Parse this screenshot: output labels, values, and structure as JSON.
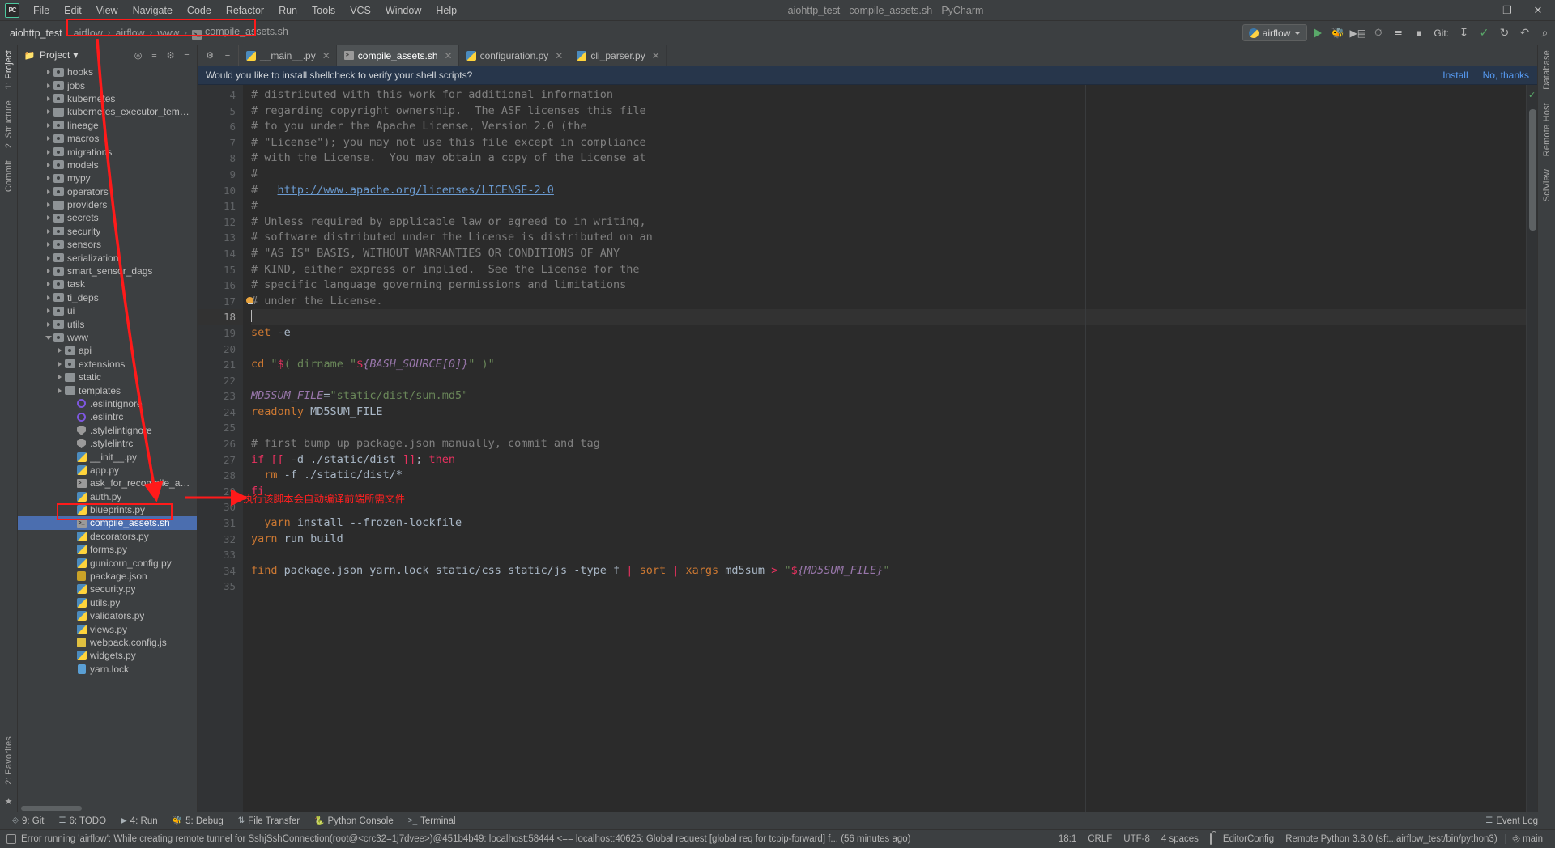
{
  "window": {
    "title": "aiohttp_test - compile_assets.sh - PyCharm",
    "minimize": "—",
    "maximize": "❐",
    "close": "✕"
  },
  "menubar": [
    {
      "label": "File"
    },
    {
      "label": "Edit"
    },
    {
      "label": "View"
    },
    {
      "label": "Navigate"
    },
    {
      "label": "Code"
    },
    {
      "label": "Refactor"
    },
    {
      "label": "Run"
    },
    {
      "label": "Tools"
    },
    {
      "label": "VCS"
    },
    {
      "label": "Window"
    },
    {
      "label": "Help"
    }
  ],
  "navbar": {
    "project": "aiohttp_test",
    "breadcrumbs": [
      "airflow",
      "airflow",
      "www",
      "compile_assets.sh"
    ],
    "separator": "›",
    "run_config": "airflow",
    "git_label": "Git:",
    "search_icon": "⌕"
  },
  "left_rail": {
    "top": [
      "1: Project",
      "2: Structure"
    ],
    "mid": [
      "Commit"
    ],
    "bottom": [
      "2: Favorites"
    ]
  },
  "right_rail": [
    "Database",
    "Remote Host",
    "SciView"
  ],
  "project_panel": {
    "title": "Project",
    "dropdown": "▾",
    "tree": [
      {
        "label": "hooks",
        "indent": 2,
        "type": "folder-src",
        "arrow": "closed"
      },
      {
        "label": "jobs",
        "indent": 2,
        "type": "folder-src",
        "arrow": "closed"
      },
      {
        "label": "kubernetes",
        "indent": 2,
        "type": "folder-src",
        "arrow": "closed"
      },
      {
        "label": "kubernetes_executor_templates",
        "indent": 2,
        "type": "folder",
        "arrow": "closed"
      },
      {
        "label": "lineage",
        "indent": 2,
        "type": "folder-src",
        "arrow": "closed"
      },
      {
        "label": "macros",
        "indent": 2,
        "type": "folder-src",
        "arrow": "closed"
      },
      {
        "label": "migrations",
        "indent": 2,
        "type": "folder-src",
        "arrow": "closed"
      },
      {
        "label": "models",
        "indent": 2,
        "type": "folder-src",
        "arrow": "closed"
      },
      {
        "label": "mypy",
        "indent": 2,
        "type": "folder-src",
        "arrow": "closed"
      },
      {
        "label": "operators",
        "indent": 2,
        "type": "folder-src",
        "arrow": "closed"
      },
      {
        "label": "providers",
        "indent": 2,
        "type": "folder",
        "arrow": "closed"
      },
      {
        "label": "secrets",
        "indent": 2,
        "type": "folder-src",
        "arrow": "closed"
      },
      {
        "label": "security",
        "indent": 2,
        "type": "folder-src",
        "arrow": "closed"
      },
      {
        "label": "sensors",
        "indent": 2,
        "type": "folder-src",
        "arrow": "closed"
      },
      {
        "label": "serialization",
        "indent": 2,
        "type": "folder-src",
        "arrow": "closed"
      },
      {
        "label": "smart_sensor_dags",
        "indent": 2,
        "type": "folder-src",
        "arrow": "closed"
      },
      {
        "label": "task",
        "indent": 2,
        "type": "folder-src",
        "arrow": "closed"
      },
      {
        "label": "ti_deps",
        "indent": 2,
        "type": "folder-src",
        "arrow": "closed"
      },
      {
        "label": "ui",
        "indent": 2,
        "type": "folder-src",
        "arrow": "closed"
      },
      {
        "label": "utils",
        "indent": 2,
        "type": "folder-src",
        "arrow": "closed"
      },
      {
        "label": "www",
        "indent": 2,
        "type": "folder-src",
        "arrow": "open"
      },
      {
        "label": "api",
        "indent": 3,
        "type": "folder-src",
        "arrow": "closed"
      },
      {
        "label": "extensions",
        "indent": 3,
        "type": "folder-src",
        "arrow": "closed"
      },
      {
        "label": "static",
        "indent": 3,
        "type": "folder",
        "arrow": "closed"
      },
      {
        "label": "templates",
        "indent": 3,
        "type": "folder",
        "arrow": "closed"
      },
      {
        "label": ".eslintignore",
        "indent": 4,
        "type": "eslint",
        "arrow": "none"
      },
      {
        "label": ".eslintrc",
        "indent": 4,
        "type": "eslint",
        "arrow": "none"
      },
      {
        "label": ".stylelintignore",
        "indent": 4,
        "type": "stylelint",
        "arrow": "none"
      },
      {
        "label": ".stylelintrc",
        "indent": 4,
        "type": "stylelint",
        "arrow": "none"
      },
      {
        "label": "__init__.py",
        "indent": 4,
        "type": "py",
        "arrow": "none"
      },
      {
        "label": "app.py",
        "indent": 4,
        "type": "py",
        "arrow": "none"
      },
      {
        "label": "ask_for_recompile_assets_if_needed.sh",
        "indent": 4,
        "type": "sh",
        "arrow": "none"
      },
      {
        "label": "auth.py",
        "indent": 4,
        "type": "py",
        "arrow": "none"
      },
      {
        "label": "blueprints.py",
        "indent": 4,
        "type": "py",
        "arrow": "none"
      },
      {
        "label": "compile_assets.sh",
        "indent": 4,
        "type": "sh",
        "arrow": "none",
        "selected": true
      },
      {
        "label": "decorators.py",
        "indent": 4,
        "type": "py",
        "arrow": "none"
      },
      {
        "label": "forms.py",
        "indent": 4,
        "type": "py",
        "arrow": "none"
      },
      {
        "label": "gunicorn_config.py",
        "indent": 4,
        "type": "py",
        "arrow": "none"
      },
      {
        "label": "package.json",
        "indent": 4,
        "type": "json",
        "arrow": "none"
      },
      {
        "label": "security.py",
        "indent": 4,
        "type": "py",
        "arrow": "none"
      },
      {
        "label": "utils.py",
        "indent": 4,
        "type": "py",
        "arrow": "none"
      },
      {
        "label": "validators.py",
        "indent": 4,
        "type": "py",
        "arrow": "none"
      },
      {
        "label": "views.py",
        "indent": 4,
        "type": "py",
        "arrow": "none"
      },
      {
        "label": "webpack.config.js",
        "indent": 4,
        "type": "js",
        "arrow": "none"
      },
      {
        "label": "widgets.py",
        "indent": 4,
        "type": "py",
        "arrow": "none"
      },
      {
        "label": "yarn.lock",
        "indent": 4,
        "type": "lock",
        "arrow": "none"
      }
    ]
  },
  "editor": {
    "tabs": [
      {
        "label": "__main__.py",
        "icon": "python-icon",
        "active": false
      },
      {
        "label": "compile_assets.sh",
        "icon": "shell-icon",
        "active": true
      },
      {
        "label": "configuration.py",
        "icon": "python-icon",
        "active": false
      },
      {
        "label": "cli_parser.py",
        "icon": "python-icon",
        "active": false
      }
    ],
    "notification": {
      "message": "Would you like to install shellcheck to verify your shell scripts?",
      "install": "Install",
      "dismiss": "No, thanks"
    },
    "first_line": 4,
    "cursor_line": 18,
    "lines": [
      {
        "n": 4,
        "tokens": [
          {
            "t": "# distributed with this work for additional information",
            "c": "cmt"
          }
        ]
      },
      {
        "n": 5,
        "tokens": [
          {
            "t": "# regarding copyright ownership.  The ASF licenses this file",
            "c": "cmt"
          }
        ]
      },
      {
        "n": 6,
        "tokens": [
          {
            "t": "# to you under the Apache License, Version 2.0 (the",
            "c": "cmt"
          }
        ]
      },
      {
        "n": 7,
        "tokens": [
          {
            "t": "# \"License\"); you may not use this file except in compliance",
            "c": "cmt"
          }
        ]
      },
      {
        "n": 8,
        "tokens": [
          {
            "t": "# with the License.  You may obtain a copy of the License at",
            "c": "cmt"
          }
        ]
      },
      {
        "n": 9,
        "tokens": [
          {
            "t": "#",
            "c": "cmt"
          }
        ]
      },
      {
        "n": 10,
        "tokens": [
          {
            "t": "#   ",
            "c": "cmt"
          },
          {
            "t": "http://www.apache.org/licenses/LICENSE-2.0",
            "c": "lnk"
          }
        ]
      },
      {
        "n": 11,
        "tokens": [
          {
            "t": "#",
            "c": "cmt"
          }
        ]
      },
      {
        "n": 12,
        "tokens": [
          {
            "t": "# Unless required by applicable law or agreed to in writing,",
            "c": "cmt"
          }
        ]
      },
      {
        "n": 13,
        "tokens": [
          {
            "t": "# software distributed under the License is distributed on an",
            "c": "cmt"
          }
        ]
      },
      {
        "n": 14,
        "tokens": [
          {
            "t": "# \"AS IS\" BASIS, WITHOUT WARRANTIES OR CONDITIONS OF ANY",
            "c": "cmt"
          }
        ]
      },
      {
        "n": 15,
        "tokens": [
          {
            "t": "# KIND, either express or implied.  See the License for the",
            "c": "cmt"
          }
        ]
      },
      {
        "n": 16,
        "tokens": [
          {
            "t": "# specific language governing permissions and limitations",
            "c": "cmt"
          }
        ]
      },
      {
        "n": 17,
        "tokens": [
          {
            "t": "# under the License.",
            "c": "cmt"
          }
        ]
      },
      {
        "n": 18,
        "tokens": []
      },
      {
        "n": 19,
        "tokens": [
          {
            "t": "set",
            "c": "kw"
          },
          {
            "t": " -e",
            "c": "opr"
          }
        ]
      },
      {
        "n": 20,
        "tokens": []
      },
      {
        "n": 21,
        "tokens": [
          {
            "t": "cd",
            "c": "kw"
          },
          {
            "t": " ",
            "c": "opr"
          },
          {
            "t": "\"",
            "c": "str"
          },
          {
            "t": "$",
            "c": "dol"
          },
          {
            "t": "( dirname ",
            "c": "str"
          },
          {
            "t": "\"",
            "c": "str"
          },
          {
            "t": "$",
            "c": "dol"
          },
          {
            "t": "{BASH_SOURCE[0]}",
            "c": "var"
          },
          {
            "t": "\" )\"",
            "c": "str"
          }
        ]
      },
      {
        "n": 22,
        "tokens": []
      },
      {
        "n": 23,
        "tokens": [
          {
            "t": "MD5SUM_FILE",
            "c": "var"
          },
          {
            "t": "=",
            "c": "opr"
          },
          {
            "t": "\"static/dist/sum.md5\"",
            "c": "str"
          }
        ]
      },
      {
        "n": 24,
        "tokens": [
          {
            "t": "readonly",
            "c": "kw"
          },
          {
            "t": " MD5SUM_FILE",
            "c": "opr"
          }
        ]
      },
      {
        "n": 25,
        "tokens": []
      },
      {
        "n": 26,
        "tokens": [
          {
            "t": "# first bump up package.json manually, commit and tag",
            "c": "cmt"
          }
        ]
      },
      {
        "n": 27,
        "tokens": [
          {
            "t": "if",
            "c": "ctl"
          },
          {
            "t": " ",
            "c": "opr"
          },
          {
            "t": "[[",
            "c": "ctl"
          },
          {
            "t": " -d ./static/dist ",
            "c": "opr"
          },
          {
            "t": "]]",
            "c": "ctl"
          },
          {
            "t": "; ",
            "c": "opr"
          },
          {
            "t": "then",
            "c": "ctl"
          }
        ]
      },
      {
        "n": 28,
        "tokens": [
          {
            "t": "  ",
            "c": "opr"
          },
          {
            "t": "rm",
            "c": "kw"
          },
          {
            "t": " -f ./static/dist/*",
            "c": "opr"
          }
        ]
      },
      {
        "n": 29,
        "tokens": [
          {
            "t": "fi",
            "c": "ctl"
          }
        ]
      },
      {
        "n": 30,
        "tokens": []
      },
      {
        "n": 31,
        "tokens": [
          {
            "t": "  ",
            "c": "opr"
          },
          {
            "t": "yarn",
            "c": "kw"
          },
          {
            "t": " install --frozen-lockfile",
            "c": "opr"
          }
        ]
      },
      {
        "n": 32,
        "tokens": [
          {
            "t": "yarn",
            "c": "kw"
          },
          {
            "t": " run build",
            "c": "opr"
          }
        ]
      },
      {
        "n": 33,
        "tokens": []
      },
      {
        "n": 34,
        "tokens": [
          {
            "t": "find",
            "c": "kw"
          },
          {
            "t": " package.json yarn.lock static/css static/js -type f ",
            "c": "opr"
          },
          {
            "t": "|",
            "c": "ctl"
          },
          {
            "t": " ",
            "c": "opr"
          },
          {
            "t": "sort",
            "c": "kw"
          },
          {
            "t": " ",
            "c": "opr"
          },
          {
            "t": "|",
            "c": "ctl"
          },
          {
            "t": " ",
            "c": "opr"
          },
          {
            "t": "xargs",
            "c": "kw"
          },
          {
            "t": " md5sum ",
            "c": "opr"
          },
          {
            "t": ">",
            "c": "ctl"
          },
          {
            "t": " ",
            "c": "opr"
          },
          {
            "t": "\"",
            "c": "str"
          },
          {
            "t": "$",
            "c": "dol"
          },
          {
            "t": "{MD5SUM_FILE}",
            "c": "var"
          },
          {
            "t": "\"",
            "c": "str"
          }
        ]
      },
      {
        "n": 35,
        "tokens": []
      }
    ]
  },
  "annotations": {
    "code_note": "执行该脚本会自动编译前端所需文件",
    "color": "#ff1a1a"
  },
  "bottom_bar": {
    "items": [
      {
        "label": "9: Git",
        "icon": "git-icon"
      },
      {
        "label": "6: TODO",
        "icon": "todo-icon"
      },
      {
        "label": "4: Run",
        "icon": "run-icon"
      },
      {
        "label": "5: Debug",
        "icon": "debug-icon"
      },
      {
        "label": "File Transfer",
        "icon": "transfer-icon"
      },
      {
        "label": "Python Console",
        "icon": "python-console-icon"
      },
      {
        "label": "Terminal",
        "icon": "terminal-icon"
      }
    ],
    "event_log": "Event Log"
  },
  "status_bar": {
    "message": "Error running 'airflow': While creating remote tunnel for SshjSshConnection(root@<crc32=1j7dvee>)@451b4b49: localhost:58444 <== localhost:40625: Global request [global req for tcpip-forward] f... (56 minutes ago)",
    "caret": "18:1",
    "line_sep": "CRLF",
    "encoding": "UTF-8",
    "indent": "4 spaces",
    "editor_config": "EditorConfig",
    "interpreter": "Remote Python 3.8.0 (sft...airflow_test/bin/python3)",
    "branch": "main"
  }
}
